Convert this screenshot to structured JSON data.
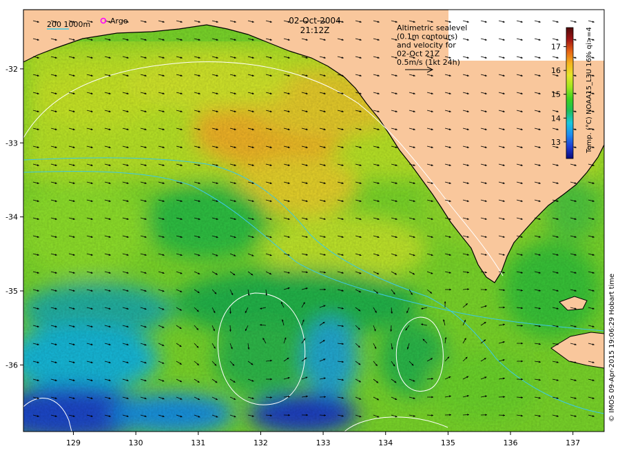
{
  "header": {
    "date": "02-Oct-2004",
    "time": "21:12Z"
  },
  "scale_label": "200  1000m",
  "argo_label": "Argo",
  "annotation_lines": [
    "Altimetric sealevel",
    "(0.1m contours)",
    "and velocity for",
    "02-Oct 21Z",
    "0.5m/s (1kt 24h)"
  ],
  "colorbar": {
    "label": "Temp. (°C) NOAA15_L3U 16% qi>=4",
    "ticks": [
      "13",
      "14",
      "15",
      "16",
      "17"
    ],
    "tick_values": [
      13,
      14,
      15,
      16,
      17
    ],
    "range": [
      12.3,
      17.8
    ],
    "stops": [
      "#0a0a7a",
      "#1e3cd2",
      "#1e8cf0",
      "#19c8dc",
      "#1ebe5a",
      "#3cd21e",
      "#a0e61e",
      "#e6e628",
      "#f5b41e",
      "#e66414",
      "#a01414",
      "#500a0a"
    ]
  },
  "axes": {
    "x_ticks": [
      "129",
      "130",
      "131",
      "132",
      "133",
      "134",
      "135",
      "136",
      "137"
    ],
    "x_values": [
      129,
      130,
      131,
      132,
      133,
      134,
      135,
      136,
      137
    ],
    "x_range": [
      128.2,
      137.5
    ],
    "y_ticks": [
      "-32",
      "-33",
      "-34",
      "-35",
      "-36"
    ],
    "y_values": [
      -32,
      -33,
      -34,
      -35,
      -36
    ],
    "y_range": [
      -36.9,
      -31.2
    ]
  },
  "credit": "© IMOS 09-Apr-2015 19:06:29 Hobart time",
  "colors": {
    "land": "#f9c79c",
    "coast": "#000000",
    "contour": "#ffffff",
    "isobath": "#3cc8e6",
    "argo": "#ff00ff"
  }
}
